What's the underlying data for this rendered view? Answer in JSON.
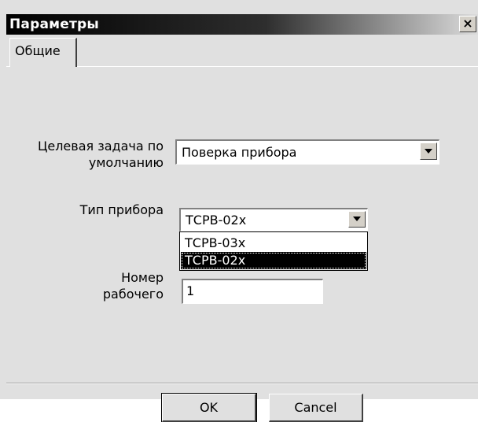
{
  "window": {
    "title": "Параметры",
    "close_symbol": "×"
  },
  "tabs": [
    {
      "label": "Общие",
      "active": true
    }
  ],
  "form": {
    "target_task_label_line1": "Целевая задача по",
    "target_task_label_line2": "умолчанию",
    "target_task_value": "Поверка прибора",
    "device_type_label": "Тип прибора",
    "device_type_value": "ТСРВ-02х",
    "device_type_options": [
      "ТСРВ-03х",
      "ТСРВ-02х"
    ],
    "device_type_selected_index": 1,
    "worker_number_label_line1": "Номер",
    "worker_number_label_line2": "рабочего",
    "worker_number_value": "1"
  },
  "buttons": {
    "ok_label": "OK",
    "cancel_label": "Cancel"
  },
  "icons": {
    "close": "close-icon",
    "dropdown": "chevron-down-icon"
  }
}
